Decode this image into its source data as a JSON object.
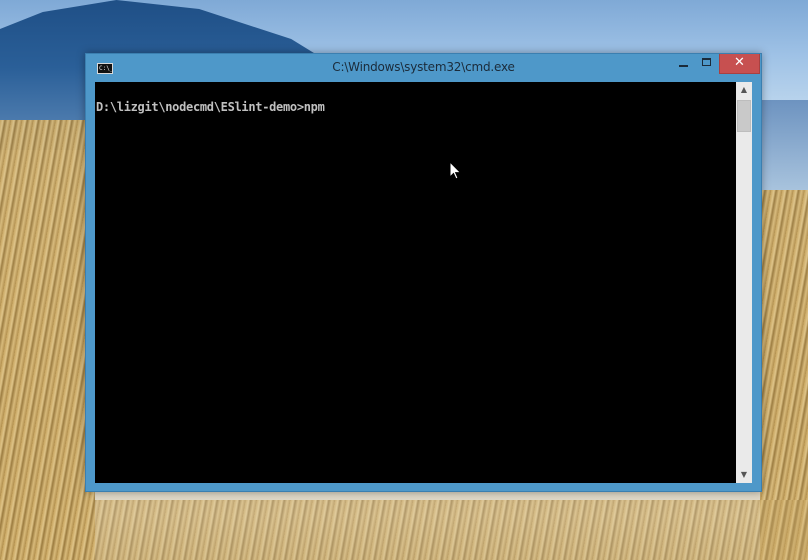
{
  "window": {
    "title": "C:\\Windows\\system32\\cmd.exe",
    "icon_text": "C:\\_",
    "close_label": "✕"
  },
  "console": {
    "lines": [
      "D:\\lizgit\\nodecmd\\ESlint-demo>npm"
    ]
  },
  "colors": {
    "titlebar": "#4e98c9",
    "close_button": "#c75050",
    "console_background": "#000000",
    "console_text": "#c0c0c0"
  },
  "icons": {
    "app": "cmd-icon",
    "minimize": "minimize-icon",
    "maximize": "maximize-icon",
    "close": "close-icon",
    "scroll_up": "scroll-up-icon",
    "scroll_down": "scroll-down-icon",
    "pointer": "mouse-pointer-icon"
  }
}
